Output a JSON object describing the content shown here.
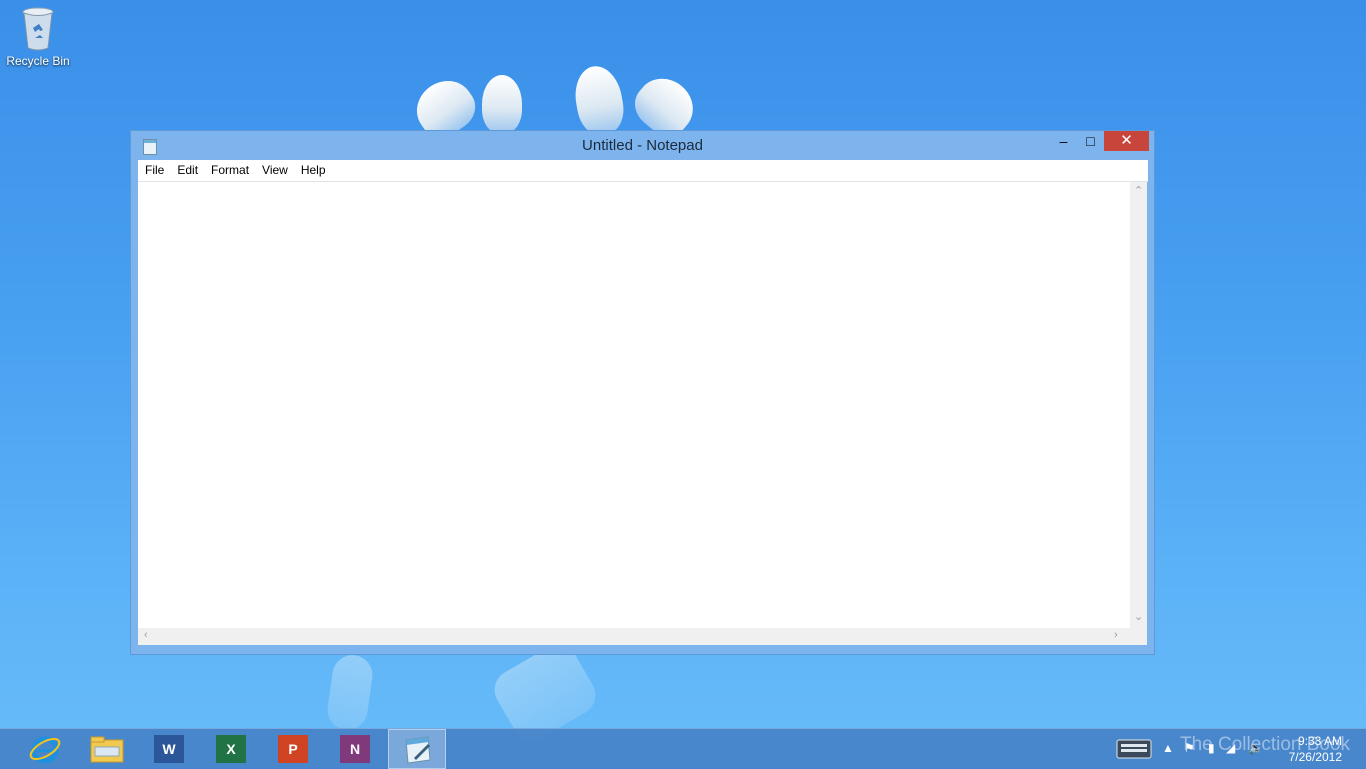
{
  "desktop": {
    "recycle_bin_label": "Recycle Bin"
  },
  "notepad": {
    "title": "Untitled - Notepad",
    "controls": {
      "minimize": "–",
      "maximize": "□",
      "close": "✕"
    },
    "menu": [
      "File",
      "Edit",
      "Format",
      "View",
      "Help"
    ],
    "content": ""
  },
  "taskbar": {
    "apps": [
      {
        "name": "Internet Explorer",
        "icon": "ie-icon"
      },
      {
        "name": "File Explorer",
        "icon": "folder-icon"
      },
      {
        "name": "Word",
        "icon": "word-icon",
        "letter": "W",
        "color": "#2b579a"
      },
      {
        "name": "Excel",
        "icon": "excel-icon",
        "letter": "X",
        "color": "#217346"
      },
      {
        "name": "PowerPoint",
        "icon": "powerpoint-icon",
        "letter": "P",
        "color": "#d04423"
      },
      {
        "name": "OneNote",
        "icon": "onenote-icon",
        "letter": "N",
        "color": "#80397b"
      },
      {
        "name": "Notepad",
        "icon": "notepad-icon",
        "active": true
      }
    ],
    "clock": {
      "time": "9:33 AM",
      "date": "7/26/2012"
    },
    "watermark": "The Collection Book"
  },
  "colors": {
    "accent": "#3a8fe8",
    "close_button": "#c7453a"
  }
}
